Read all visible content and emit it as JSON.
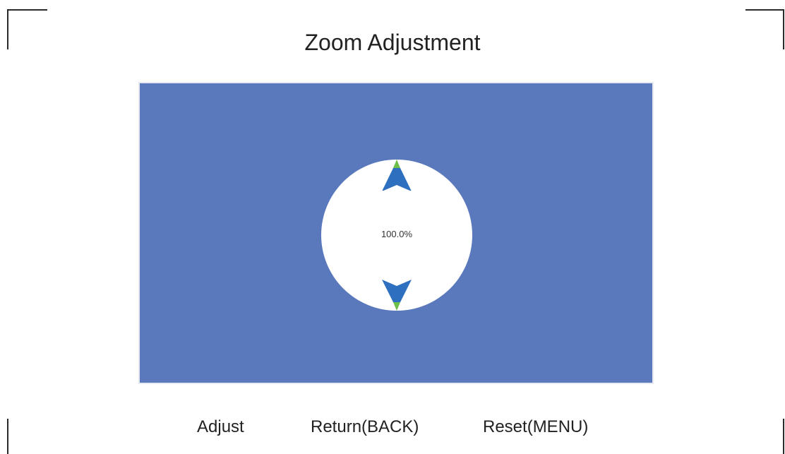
{
  "screen": {
    "title": "Zoom Adjustment"
  },
  "zoom": {
    "value": "100.0%",
    "up_icon": "arrow-up-icon",
    "down_icon": "arrow-down-icon"
  },
  "colors": {
    "panel": "#5a79bd",
    "arrow_blue": "#2f6fbf",
    "arrow_green": "#6cc04a",
    "dial": "#ffffff"
  },
  "footer": {
    "adjust_label": "Adjust",
    "return_label": "Return(BACK)",
    "reset_label": "Reset(MENU)"
  }
}
